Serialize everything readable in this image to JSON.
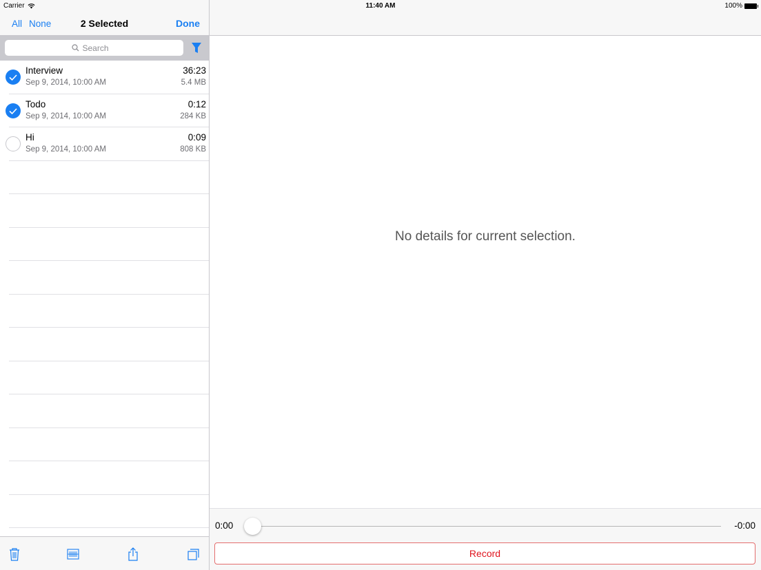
{
  "status_bar": {
    "carrier": "Carrier",
    "time": "11:40 AM",
    "battery": "100%"
  },
  "nav": {
    "all_label": "All",
    "none_label": "None",
    "title": "2 Selected",
    "done_label": "Done"
  },
  "search": {
    "placeholder": "Search"
  },
  "recordings": [
    {
      "title": "Interview",
      "date": "Sep 9, 2014, 10:00 AM",
      "duration": "36:23",
      "size": "5.4 MB",
      "selected": true
    },
    {
      "title": "Todo",
      "date": "Sep 9, 2014, 10:00 AM",
      "duration": "0:12",
      "size": "284 KB",
      "selected": true
    },
    {
      "title": "Hi",
      "date": "Sep 9, 2014, 10:00 AM",
      "duration": "0:09",
      "size": "808 KB",
      "selected": false
    }
  ],
  "detail": {
    "empty_message": "No details for current selection."
  },
  "player": {
    "time_elapsed": "0:00",
    "time_remaining": "-0:00",
    "progress": 0,
    "record_label": "Record"
  },
  "colors": {
    "accent": "#1a7ff2",
    "record": "#e0141e",
    "bar_bg": "#f7f7f7"
  },
  "icons": {
    "toolbar": [
      "trash-icon",
      "barcode-icon",
      "share-icon",
      "duplicate-icon"
    ],
    "filter": "filter-icon",
    "search": "search-icon",
    "wifi": "wifi-icon",
    "battery": "battery-icon"
  }
}
